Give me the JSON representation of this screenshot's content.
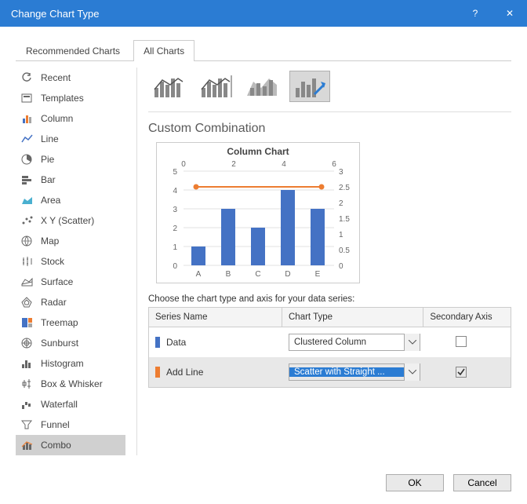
{
  "titlebar": {
    "title": "Change Chart Type",
    "help": "?",
    "close": "✕"
  },
  "tabs": {
    "recommended": "Recommended Charts",
    "all": "All Charts"
  },
  "sidebar": {
    "items": [
      {
        "label": "Recent"
      },
      {
        "label": "Templates"
      },
      {
        "label": "Column"
      },
      {
        "label": "Line"
      },
      {
        "label": "Pie"
      },
      {
        "label": "Bar"
      },
      {
        "label": "Area"
      },
      {
        "label": "X Y (Scatter)"
      },
      {
        "label": "Map"
      },
      {
        "label": "Stock"
      },
      {
        "label": "Surface"
      },
      {
        "label": "Radar"
      },
      {
        "label": "Treemap"
      },
      {
        "label": "Sunburst"
      },
      {
        "label": "Histogram"
      },
      {
        "label": "Box & Whisker"
      },
      {
        "label": "Waterfall"
      },
      {
        "label": "Funnel"
      },
      {
        "label": "Combo"
      }
    ]
  },
  "main": {
    "heading": "Custom Combination",
    "chart_title": "Column Chart",
    "instr": "Choose the chart type and axis for your data series:",
    "headers": {
      "name": "Series Name",
      "type": "Chart Type",
      "axis": "Secondary Axis"
    },
    "series": [
      {
        "swatch": "#4472c4",
        "name": "Data",
        "type": "Clustered Column",
        "secondary": false,
        "highlighted": false
      },
      {
        "swatch": "#ed7d31",
        "name": "Add Line",
        "type": "Scatter with Straight ...",
        "secondary": true,
        "highlighted": true
      }
    ]
  },
  "footer": {
    "ok": "OK",
    "cancel": "Cancel"
  },
  "chart_data": {
    "type": "combo",
    "title": "Column Chart",
    "categories": [
      "A",
      "B",
      "C",
      "D",
      "E"
    ],
    "primary_ylim": [
      0,
      5
    ],
    "secondary_xlim": [
      0,
      6
    ],
    "secondary_ylim": [
      0,
      3
    ],
    "series": [
      {
        "name": "Data",
        "type": "bar",
        "axis": "primary",
        "values": [
          1,
          3,
          2,
          4,
          3
        ]
      },
      {
        "name": "Add Line",
        "type": "line",
        "axis": "secondary",
        "x": [
          0.5,
          5.5
        ],
        "y": [
          2.5,
          2.5
        ]
      }
    ]
  }
}
